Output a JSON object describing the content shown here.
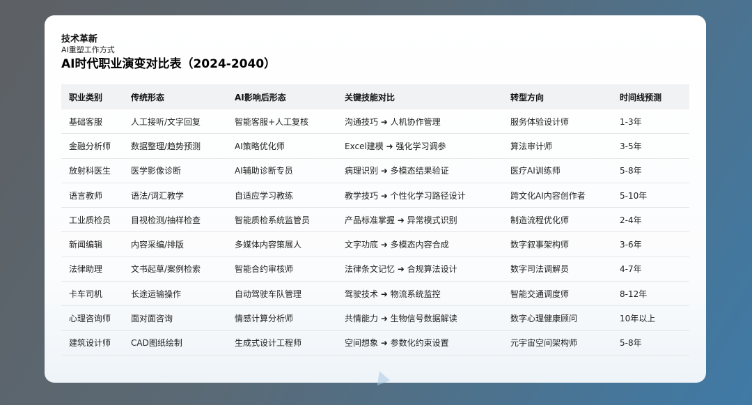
{
  "header": {
    "brand": "技术革新",
    "subtitle": "AI重塑工作方式",
    "title": "AI时代职业演变对比表（2024-2040）"
  },
  "table": {
    "columns": [
      "职业类别",
      "传统形态",
      "AI影响后形态",
      "关键技能对比",
      "转型方向",
      "时间线预测"
    ],
    "rows": [
      [
        "基础客服",
        "人工接听/文字回复",
        "智能客服+人工复核",
        "沟通技巧 ➜ 人机协作管理",
        "服务体验设计师",
        "1-3年"
      ],
      [
        "金融分析师",
        "数据整理/趋势预测",
        "AI策略优化师",
        "Excel建模 ➜ 强化学习调参",
        "算法审计师",
        "3-5年"
      ],
      [
        "放射科医生",
        "医学影像诊断",
        "AI辅助诊断专员",
        "病理识别 ➜ 多模态结果验证",
        "医疗AI训练师",
        "5-8年"
      ],
      [
        "语言教师",
        "语法/词汇教学",
        "自适应学习教练",
        "教学技巧 ➜ 个性化学习路径设计",
        "跨文化AI内容创作者",
        "5-10年"
      ],
      [
        "工业质检员",
        "目视检测/抽样检查",
        "智能质检系统监管员",
        "产品标准掌握 ➜ 异常模式识别",
        "制造流程优化师",
        "2-4年"
      ],
      [
        "新闻编辑",
        "内容采编/排版",
        "多媒体内容策展人",
        "文字功底 ➜ 多模态内容合成",
        "数字叙事架构师",
        "3-6年"
      ],
      [
        "法律助理",
        "文书起草/案例检索",
        "智能合约审核师",
        "法律条文记忆 ➜ 合规算法设计",
        "数字司法调解员",
        "4-7年"
      ],
      [
        "卡车司机",
        "长途运输操作",
        "自动驾驶车队管理",
        "驾驶技术 ➜ 物流系统监控",
        "智能交通调度师",
        "8-12年"
      ],
      [
        "心理咨询师",
        "面对面咨询",
        "情感计算分析师",
        "共情能力 ➜ 生物信号数据解读",
        "数字心理健康顾问",
        "10年以上"
      ],
      [
        "建筑设计师",
        "CAD图纸绘制",
        "生成式设计工程师",
        "空间想象 ➜ 参数化约束设置",
        "元宇宙空间架构师",
        "5-8年"
      ]
    ]
  }
}
